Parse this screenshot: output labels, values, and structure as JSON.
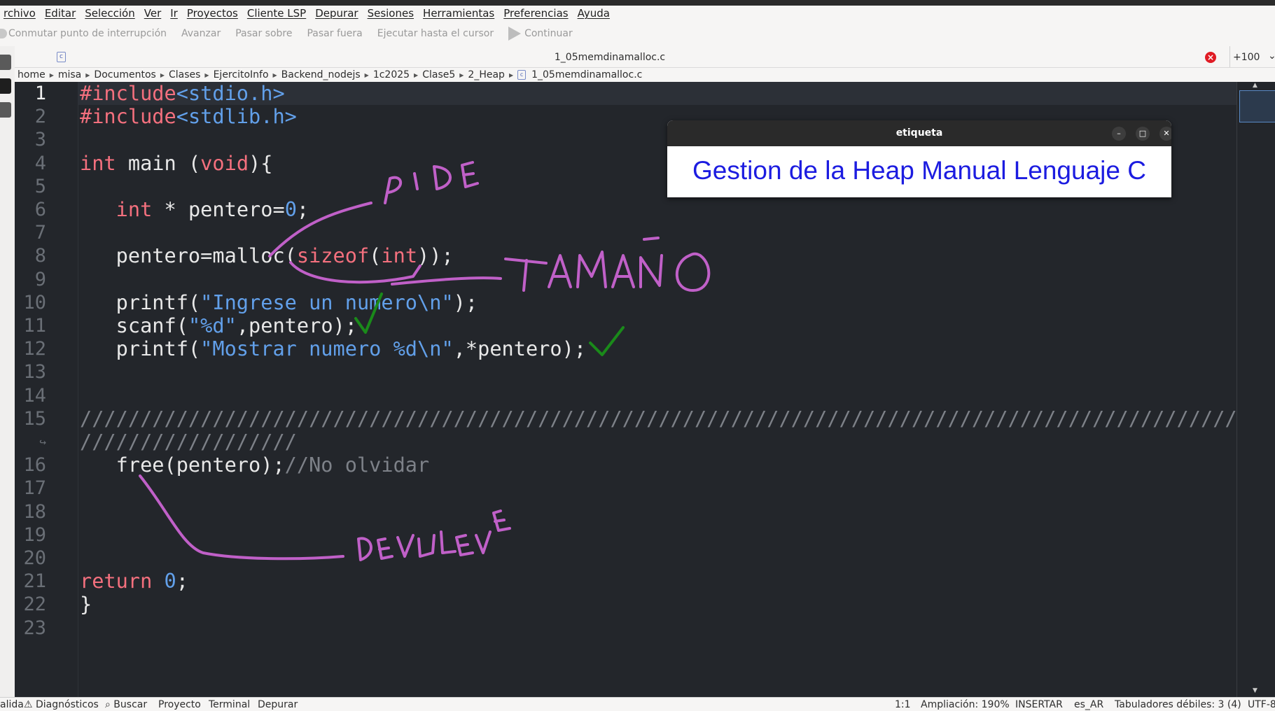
{
  "menubar": {
    "items": [
      "rchivo",
      "Editar",
      "Selección",
      "Ver",
      "Ir",
      "Proyectos",
      "Cliente LSP",
      "Depurar",
      "Sesiones",
      "Herramientas",
      "Preferencias",
      "Ayuda"
    ]
  },
  "debugbar": {
    "items": [
      "Conmutar punto de interrupción",
      "Avanzar",
      "Pasar sobre",
      "Pasar fuera",
      "Ejecutar hasta el cursor",
      "Continuar"
    ]
  },
  "tab": {
    "icon": "c-file-icon",
    "icon_text": "c",
    "title": "1_05memdinamalloc.c",
    "more": "+100"
  },
  "breadcrumb": [
    "home",
    "misa",
    "Documentos",
    "Clases",
    "EjercitoInfo",
    "Backend_nodejs",
    "1c2025",
    "Clase5",
    "2_Heap",
    "1_05memdinamalloc.c"
  ],
  "editor": {
    "line_numbers": [
      "1",
      "2",
      "3",
      "4",
      "5",
      "6",
      "7",
      "8",
      "9",
      "10",
      "11",
      "12",
      "13",
      "14",
      "15",
      "↪",
      "16",
      "17",
      "18",
      "19",
      "20",
      "21",
      "22",
      "23"
    ],
    "lines": [
      [
        {
          "t": "#include",
          "c": "kw"
        },
        {
          "t": "<stdio.h>",
          "c": "str"
        }
      ],
      [
        {
          "t": "#include",
          "c": "kw"
        },
        {
          "t": "<stdlib.h>",
          "c": "str"
        }
      ],
      [],
      [
        {
          "t": "int",
          "c": "kw"
        },
        {
          "t": " main (",
          "c": ""
        },
        {
          "t": "void",
          "c": "kw"
        },
        {
          "t": "){",
          "c": ""
        }
      ],
      [],
      [
        {
          "t": "   ",
          "c": ""
        },
        {
          "t": "int",
          "c": "kw"
        },
        {
          "t": " * pentero=",
          "c": ""
        },
        {
          "t": "0",
          "c": "num"
        },
        {
          "t": ";",
          "c": ""
        }
      ],
      [],
      [
        {
          "t": "   pentero=malloc(",
          "c": ""
        },
        {
          "t": "sizeof",
          "c": "kw"
        },
        {
          "t": "(",
          "c": ""
        },
        {
          "t": "int",
          "c": "kw"
        },
        {
          "t": "));",
          "c": ""
        }
      ],
      [],
      [
        {
          "t": "   printf(",
          "c": ""
        },
        {
          "t": "\"Ingrese un numero\\n\"",
          "c": "str"
        },
        {
          "t": ");",
          "c": ""
        }
      ],
      [
        {
          "t": "   scanf(",
          "c": ""
        },
        {
          "t": "\"%d\"",
          "c": "str"
        },
        {
          "t": ",pentero);",
          "c": ""
        }
      ],
      [
        {
          "t": "   printf(",
          "c": ""
        },
        {
          "t": "\"Mostrar numero %d\\n\"",
          "c": "str"
        },
        {
          "t": ",*pentero);",
          "c": ""
        }
      ],
      [],
      [],
      [
        {
          "t": "///////////////////////////////////////////////////////////////////////////////////////////////////",
          "c": "cmt"
        }
      ],
      [
        {
          "t": "//////////////////",
          "c": "cmt"
        }
      ],
      [
        {
          "t": "   free(pentero);",
          "c": ""
        },
        {
          "t": "//No olvidar",
          "c": "cmt"
        }
      ],
      [],
      [],
      [],
      [],
      [
        {
          "t": "return",
          "c": "kw"
        },
        {
          "t": " ",
          "c": ""
        },
        {
          "t": "0",
          "c": "num"
        },
        {
          "t": ";",
          "c": ""
        }
      ],
      [
        {
          "t": "}",
          "c": ""
        }
      ],
      []
    ]
  },
  "popup": {
    "title": "etiqueta",
    "label": "Gestion de la Heap Manual Lenguaje C",
    "minimize": "–",
    "maximize": "□",
    "close": "✕"
  },
  "annotations": {
    "pide": "PIDE",
    "tamano": "TAMAÑO",
    "devuelve": "DEVUEVE"
  },
  "statusbar": {
    "left": [
      "alida",
      "Diagnósticos",
      "Buscar",
      "Proyecto",
      "Terminal",
      "Depurar"
    ],
    "right": [
      "1:1",
      "Ampliación: 190%",
      "INSERTAR",
      "es_AR",
      "Tabuladores débiles: 3 (4)",
      "UTF-8"
    ]
  },
  "colors": {
    "editor_bg": "#23262b",
    "keyword": "#f4707e",
    "string": "#62a0ea",
    "comment": "#7d8188",
    "annotation_pink": "#c060c8",
    "annotation_green": "#1a8a1a",
    "popup_text": "#1c1ce0"
  }
}
